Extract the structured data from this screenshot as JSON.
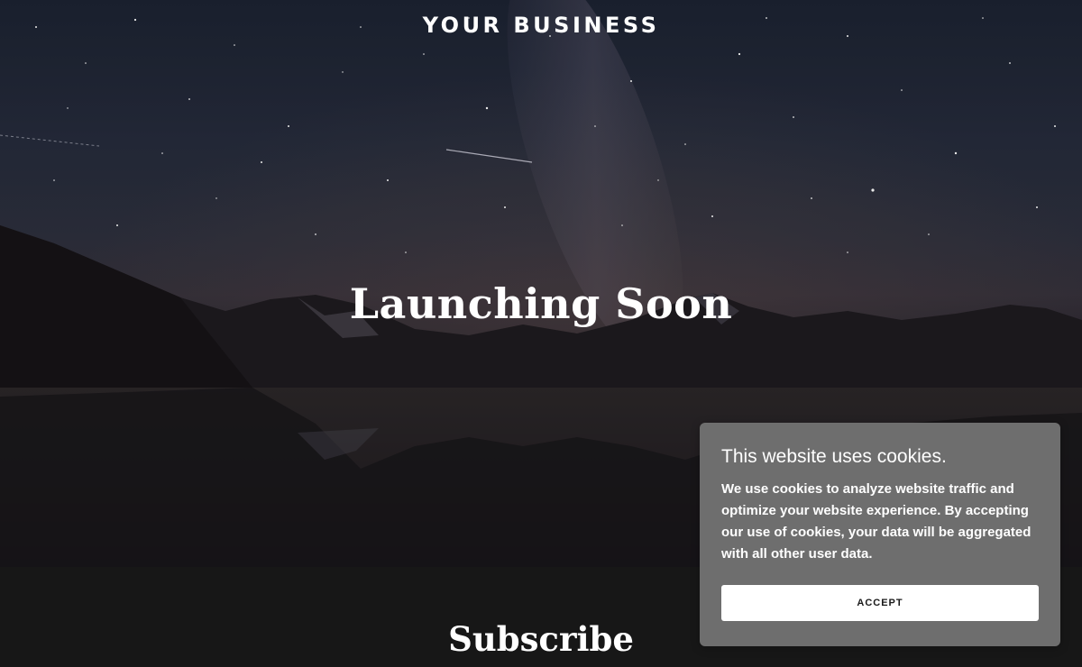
{
  "header": {
    "brand": "YOUR BUSINESS"
  },
  "hero": {
    "title": "Launching Soon"
  },
  "subscribe": {
    "title": "Subscribe"
  },
  "cookie_banner": {
    "title": "This website uses cookies.",
    "text": "We use cookies to analyze website traffic and optimize your website experience. By accepting our use of cookies, your data will be aggregated with all other user data.",
    "accept_label": "ACCEPT"
  },
  "colors": {
    "page_background": "#171717",
    "cookie_panel": "#6e6e6e",
    "accept_button": "#ffffff",
    "text": "#ffffff"
  }
}
